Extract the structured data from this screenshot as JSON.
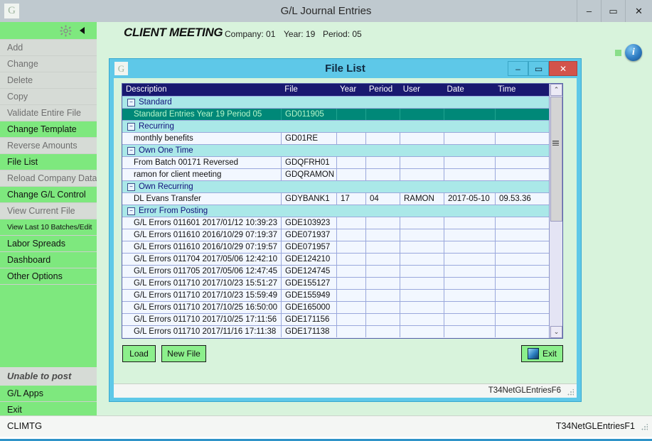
{
  "window": {
    "title": "G/L Journal Entries",
    "logo": "G",
    "minimize": "–",
    "maximize": "▭",
    "close": "✕"
  },
  "sidebar": {
    "gear_icon": "gear-icon",
    "collapse_icon": "collapse-left-icon",
    "items": [
      {
        "label": "Add",
        "enabled": false
      },
      {
        "label": "Change",
        "enabled": false
      },
      {
        "label": "Delete",
        "enabled": false
      },
      {
        "label": "Copy",
        "enabled": false
      },
      {
        "label": "Validate Entire File",
        "enabled": false
      },
      {
        "label": "Change Template",
        "enabled": true
      },
      {
        "label": "Reverse Amounts",
        "enabled": false
      },
      {
        "label": "File List",
        "enabled": true
      },
      {
        "label": "Reload Company Data",
        "enabled": false
      },
      {
        "label": "Change G/L Control",
        "enabled": true
      },
      {
        "label": "View Current File",
        "enabled": false
      },
      {
        "label": "View Last 10  Batches/Edit",
        "enabled": true,
        "small": true
      },
      {
        "label": "Labor Spreads",
        "enabled": true
      },
      {
        "label": "Dashboard",
        "enabled": true
      },
      {
        "label": "Other Options",
        "enabled": true
      }
    ],
    "note": "Unable to post",
    "footer_items": [
      {
        "label": "G/L Apps"
      },
      {
        "label": "Exit"
      }
    ]
  },
  "header": {
    "title": "CLIENT MEETING",
    "company_label": "Company: 01",
    "year_label": "Year: 19",
    "period_label": "Period: 05",
    "info_icon": "i"
  },
  "dialog": {
    "logo": "G",
    "title": "File List",
    "minimize": "–",
    "maximize": "▭",
    "close": "✕",
    "status_right": "T34NetGLEntriesF6",
    "buttons": {
      "load": "Load",
      "new_file": "New File",
      "exit": "Exit"
    },
    "scrollbar": {
      "up": "⌃",
      "down": "⌄"
    },
    "grid": {
      "columns": [
        "Description",
        "File",
        "Year",
        "Period",
        "User",
        "Date",
        "Time"
      ],
      "rows": [
        {
          "type": "group",
          "expander": "−",
          "description": "Standard"
        },
        {
          "type": "data",
          "selected": true,
          "description": "Standard Entries Year 19 Period 05",
          "file": "GD011905",
          "year": "",
          "period": "",
          "user": "",
          "date": "",
          "time": ""
        },
        {
          "type": "group",
          "expander": "−",
          "description": "Recurring"
        },
        {
          "type": "data",
          "description": "monthly benefits",
          "file": "GD01RE",
          "year": "",
          "period": "",
          "user": "",
          "date": "",
          "time": ""
        },
        {
          "type": "group",
          "expander": "−",
          "description": "Own One Time"
        },
        {
          "type": "data",
          "description": "From Batch 00171 Reversed",
          "file": "GDQFRH01",
          "year": "",
          "period": "",
          "user": "",
          "date": "",
          "time": ""
        },
        {
          "type": "data",
          "description": "ramon for client meeting",
          "file": "GDQRAMON",
          "year": "",
          "period": "",
          "user": "",
          "date": "",
          "time": ""
        },
        {
          "type": "group",
          "expander": "−",
          "description": "Own Recurring"
        },
        {
          "type": "data",
          "description": "DL Evans Transfer",
          "file": "GDYBANK1",
          "year": "17",
          "period": "04",
          "user": "RAMON",
          "date": "2017-05-10",
          "time": "09.53.36"
        },
        {
          "type": "group",
          "expander": "−",
          "description": "Error From Posting"
        },
        {
          "type": "data",
          "description": "G/L Errors 011601 2017/01/12 10:39:23",
          "file": "GDE103923",
          "year": "",
          "period": "",
          "user": "",
          "date": "",
          "time": ""
        },
        {
          "type": "data",
          "description": "G/L Errors 011610 2016/10/29 07:19:37",
          "file": "GDE071937",
          "year": "",
          "period": "",
          "user": "",
          "date": "",
          "time": ""
        },
        {
          "type": "data",
          "description": "G/L Errors 011610 2016/10/29 07:19:57",
          "file": "GDE071957",
          "year": "",
          "period": "",
          "user": "",
          "date": "",
          "time": ""
        },
        {
          "type": "data",
          "description": "G/L Errors 011704 2017/05/06 12:42:10",
          "file": "GDE124210",
          "year": "",
          "period": "",
          "user": "",
          "date": "",
          "time": ""
        },
        {
          "type": "data",
          "description": "G/L Errors 011705 2017/05/06 12:47:45",
          "file": "GDE124745",
          "year": "",
          "period": "",
          "user": "",
          "date": "",
          "time": ""
        },
        {
          "type": "data",
          "description": "G/L Errors 011710 2017/10/23 15:51:27",
          "file": "GDE155127",
          "year": "",
          "period": "",
          "user": "",
          "date": "",
          "time": ""
        },
        {
          "type": "data",
          "description": "G/L Errors 011710 2017/10/23 15:59:49",
          "file": "GDE155949",
          "year": "",
          "period": "",
          "user": "",
          "date": "",
          "time": ""
        },
        {
          "type": "data",
          "description": "G/L Errors 011710 2017/10/25 16:50:00",
          "file": "GDE165000",
          "year": "",
          "period": "",
          "user": "",
          "date": "",
          "time": ""
        },
        {
          "type": "data",
          "description": "G/L Errors 011710 2017/10/25 17:11:56",
          "file": "GDE171156",
          "year": "",
          "period": "",
          "user": "",
          "date": "",
          "time": ""
        },
        {
          "type": "data",
          "description": "G/L Errors 011710 2017/11/16 17:11:38",
          "file": "GDE171138",
          "year": "",
          "period": "",
          "user": "",
          "date": "",
          "time": ""
        }
      ]
    }
  },
  "statusbar": {
    "left": "CLIMTG",
    "right": "T34NetGLEntriesF1"
  },
  "colors": {
    "titlebar": "#bfc9cf",
    "sidebar_disabled": "#d6dbd6",
    "sidebar_enabled": "#7ee87e",
    "content_bg": "#d8f3dc",
    "dialog_frame": "#5ec8e8",
    "grid_header": "#191970",
    "group_row": "#aae8e8",
    "selected_row": "#008878",
    "button_green": "#8cef8c",
    "close_red": "#d3534b"
  }
}
